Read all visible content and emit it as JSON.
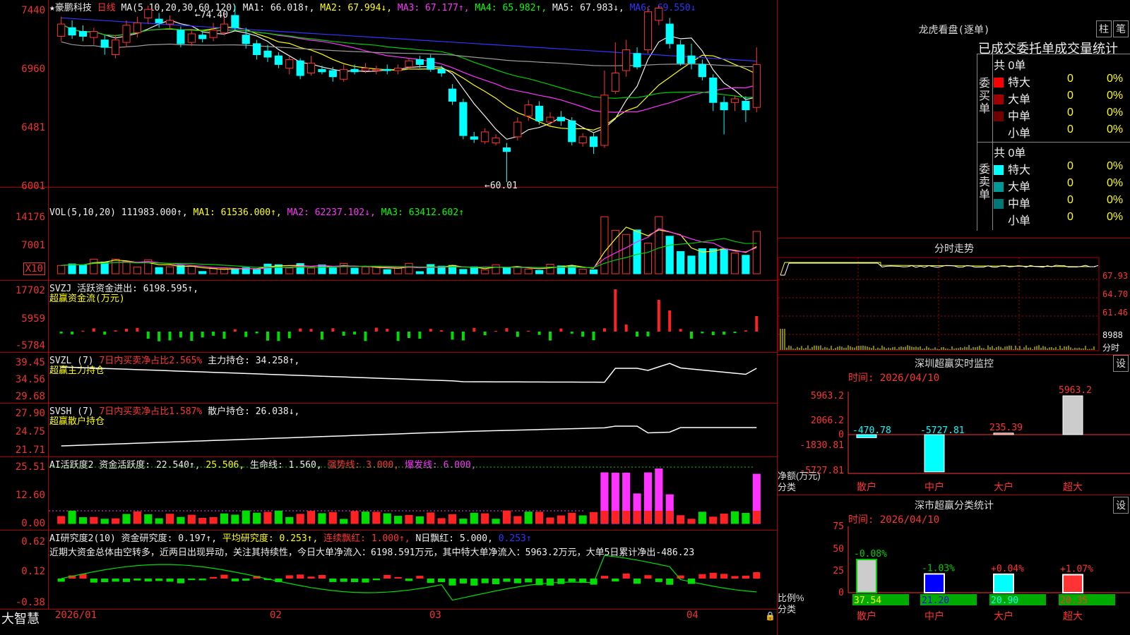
{
  "header": {
    "star": "★",
    "stock_name": "豪鹏科技",
    "period": "日线",
    "ma_label": "MA(5,10,20,30,60,120)",
    "ma1": "MA1: 66.018↑,",
    "ma2": "MA2: 67.994↓,",
    "ma3": "MA3: 67.177↑,",
    "ma4": "MA4: 65.982↑,",
    "ma5": "MA5: 67.983↓,",
    "ma6": "MA6: 69.550↓",
    "high_mark": "←74.40",
    "low_mark": "←60.01"
  },
  "main_axis": [
    "7440",
    "6960",
    "6481",
    "6001"
  ],
  "vol": {
    "title": "VOL(5,10,20)",
    "value": "111983.000↑,",
    "ma1": "MA1: 61536.000↑,",
    "ma2": "MA2: 62237.102↓,",
    "ma3": "MA3: 63412.602↑",
    "axis": [
      "14176",
      "7001"
    ],
    "unit": "X10"
  },
  "svzj": {
    "title": "SVZJ  活跃资金进出: 6198.595↑,",
    "subtitle": "超赢资金流(万元)",
    "axis": [
      "17702",
      "5959",
      "-5784"
    ]
  },
  "svzl": {
    "title": "SVZL (7)",
    "t2": "7日内买卖净占比2.565%",
    "t3": "主力持仓: 34.258↑,",
    "subtitle": "超赢主力持仓",
    "axis": [
      "39.45",
      "34.56",
      "29.68"
    ]
  },
  "svsh": {
    "title": "SVSH (7)",
    "t2": "7日内买卖净占比1.587%",
    "t3": "散户持仓: 26.038↓,",
    "subtitle": "超赢散户持仓",
    "axis": [
      "27.90",
      "24.75",
      "21.71"
    ]
  },
  "ai1": {
    "title": "AI活跃度2 资金活跃度: 22.540↑,",
    "t2": "25.506,",
    "t3": "生命线: 1.560,",
    "t4": "强势线: 3.000,",
    "t5": "爆发线: 6.000,",
    "axis": [
      "25.51",
      "12.60",
      "0.00"
    ]
  },
  "ai2": {
    "title": "AI研究度2(10) 资金研究度: 0.197↑,",
    "t2": "平均研究度: 0.253↑,",
    "t3": "连续飘红: 1.000↑,",
    "t4": "N日飘红: 5.000,",
    "t5": "0.253↑",
    "comment": "近期大资金总体由空转多，近两日出现异动，关注其持续性，今日大单净流入：6198.591万元，其中特大单净流入：5963.2万元，大单5日累计净出-486.23",
    "axis": [
      "0.62",
      "0.12",
      "-0.38"
    ]
  },
  "footer": {
    "brand": "大智慧",
    "dates": [
      "2026/01",
      "02",
      "03",
      "04"
    ]
  },
  "right": {
    "lhb_title": "龙虎看盘(逐单)",
    "btn1": "柱",
    "btn2": "笔",
    "stat_title": "已成交委托单成交量统计",
    "buy_label": "委买单",
    "sell_label": "委卖单",
    "buy_total": "共 0单",
    "sell_total": "共 0单",
    "buy_rows": [
      {
        "name": "特大",
        "count": "0",
        "pct": "0%",
        "color": "#ff0000"
      },
      {
        "name": "大单",
        "count": "0",
        "pct": "0%",
        "color": "#a00000"
      },
      {
        "name": "中单",
        "count": "0",
        "pct": "0%",
        "color": "#700000"
      },
      {
        "name": "小单",
        "count": "0",
        "pct": "0%",
        "color": "#000000"
      }
    ],
    "sell_rows": [
      {
        "name": "特大",
        "count": "0",
        "pct": "0%",
        "color": "#00ffff"
      },
      {
        "name": "大单",
        "count": "0",
        "pct": "0%",
        "color": "#009999"
      },
      {
        "name": "中单",
        "count": "0",
        "pct": "0%",
        "color": "#007777"
      },
      {
        "name": "小单",
        "count": "0",
        "pct": "0%",
        "color": "#000000"
      }
    ],
    "fenshi_title": "分时走势",
    "fenshi_axis": [
      "67.93",
      "64.70",
      "61.46",
      "8988",
      "分时"
    ],
    "monitor_title": "深圳超赢实时监控",
    "monitor_btn": "设",
    "monitor_time": "时间: 2026/04/10",
    "monitor_axis": [
      "5963.2",
      "2066.2",
      "0",
      "-1830.81",
      "-5727.81"
    ],
    "monitor_ylabel1": "净额(万元)",
    "monitor_ylabel2": "分类",
    "monitor_vals": [
      "-470.78",
      "-5727.81",
      "235.39",
      "5963.2"
    ],
    "monitor_cats": [
      "散户",
      "中户",
      "大户",
      "超大"
    ],
    "class_title": "深市超赢分类统计",
    "class_btn": "设",
    "class_time": "时间: 2026/04/10",
    "class_axis": [
      "75",
      "50",
      "25",
      "0"
    ],
    "class_ylabel1": "比例%",
    "class_ylabel2": "分类",
    "class_changes": [
      "-0.08%",
      "-1.03%",
      "+0.04%",
      "+1.07%"
    ],
    "class_vals": [
      "37.54",
      "21.20",
      "20.90",
      "20.35"
    ],
    "class_cats": [
      "散户",
      "中户",
      "大户",
      "超大"
    ]
  },
  "chart_data": {
    "type": "candlestick",
    "title": "豪鹏科技 日线",
    "ylim": [
      60.01,
      74.4
    ],
    "candles": [
      {
        "o": 71.9,
        "c": 72.9,
        "h": 73.5,
        "l": 71.5
      },
      {
        "o": 72.6,
        "c": 72.0,
        "h": 73.2,
        "l": 71.7
      },
      {
        "o": 72.3,
        "c": 71.9,
        "h": 72.8,
        "l": 71.5
      },
      {
        "o": 71.8,
        "c": 72.3,
        "h": 72.6,
        "l": 71.2
      },
      {
        "o": 71.6,
        "c": 71.0,
        "h": 72.0,
        "l": 70.4
      },
      {
        "o": 70.4,
        "c": 71.6,
        "h": 72.0,
        "l": 70.1
      },
      {
        "o": 71.4,
        "c": 72.8,
        "h": 73.2,
        "l": 71.0
      },
      {
        "o": 72.2,
        "c": 73.0,
        "h": 73.5,
        "l": 71.8
      },
      {
        "o": 73.4,
        "c": 74.1,
        "h": 74.4,
        "l": 72.9
      },
      {
        "o": 73.3,
        "c": 73.0,
        "h": 73.8,
        "l": 72.6
      },
      {
        "o": 72.9,
        "c": 73.2,
        "h": 73.6,
        "l": 72.5
      },
      {
        "o": 72.4,
        "c": 71.3,
        "h": 72.7,
        "l": 71.0
      },
      {
        "o": 71.4,
        "c": 72.1,
        "h": 72.5,
        "l": 71.1
      },
      {
        "o": 72.0,
        "c": 71.7,
        "h": 72.3,
        "l": 71.4
      },
      {
        "o": 71.8,
        "c": 72.4,
        "h": 73.0,
        "l": 71.5
      },
      {
        "o": 72.2,
        "c": 72.9,
        "h": 73.8,
        "l": 72.0
      },
      {
        "o": 73.6,
        "c": 72.6,
        "h": 74.4,
        "l": 72.4
      },
      {
        "o": 72.0,
        "c": 71.3,
        "h": 72.6,
        "l": 70.9
      },
      {
        "o": 71.3,
        "c": 70.4,
        "h": 71.6,
        "l": 70.0
      },
      {
        "o": 70.7,
        "c": 70.2,
        "h": 71.2,
        "l": 69.8
      },
      {
        "o": 70.3,
        "c": 69.6,
        "h": 70.6,
        "l": 69.3
      },
      {
        "o": 69.3,
        "c": 70.0,
        "h": 70.3,
        "l": 68.8
      },
      {
        "o": 69.9,
        "c": 68.7,
        "h": 70.1,
        "l": 68.4
      },
      {
        "o": 68.9,
        "c": 69.7,
        "h": 70.3,
        "l": 68.7
      },
      {
        "o": 69.2,
        "c": 69.0,
        "h": 69.5,
        "l": 68.8
      },
      {
        "o": 69.1,
        "c": 68.6,
        "h": 69.4,
        "l": 68.2
      },
      {
        "o": 68.4,
        "c": 69.2,
        "h": 69.6,
        "l": 68.2
      },
      {
        "o": 69.2,
        "c": 69.0,
        "h": 69.6,
        "l": 68.8
      },
      {
        "o": 69.1,
        "c": 69.3,
        "h": 69.7,
        "l": 68.9
      },
      {
        "o": 69.1,
        "c": 69.2,
        "h": 69.5,
        "l": 68.8
      },
      {
        "o": 69.2,
        "c": 69.1,
        "h": 69.6,
        "l": 68.8
      },
      {
        "o": 69.1,
        "c": 69.3,
        "h": 69.6,
        "l": 68.8
      },
      {
        "o": 69.4,
        "c": 69.9,
        "h": 70.1,
        "l": 69.2
      },
      {
        "o": 70.0,
        "c": 69.6,
        "h": 70.3,
        "l": 69.3
      },
      {
        "o": 70.1,
        "c": 69.2,
        "h": 70.4,
        "l": 69.0
      },
      {
        "o": 69.2,
        "c": 68.9,
        "h": 69.5,
        "l": 68.6
      },
      {
        "o": 67.6,
        "c": 66.6,
        "h": 68.0,
        "l": 66.3
      },
      {
        "o": 66.5,
        "c": 63.8,
        "h": 66.8,
        "l": 63.5
      },
      {
        "o": 63.7,
        "c": 63.5,
        "h": 64.1,
        "l": 63.2
      },
      {
        "o": 63.3,
        "c": 64.1,
        "h": 64.4,
        "l": 63.1
      },
      {
        "o": 63.2,
        "c": 63.6,
        "h": 63.9,
        "l": 63.0
      },
      {
        "o": 62.8,
        "c": 62.5,
        "h": 63.2,
        "l": 60.0
      },
      {
        "o": 63.7,
        "c": 64.9,
        "h": 65.3,
        "l": 63.4
      },
      {
        "o": 65.4,
        "c": 66.3,
        "h": 66.7,
        "l": 65.0
      },
      {
        "o": 66.2,
        "c": 65.0,
        "h": 66.6,
        "l": 64.7
      },
      {
        "o": 64.9,
        "c": 65.3,
        "h": 65.7,
        "l": 64.6
      },
      {
        "o": 65.3,
        "c": 65.0,
        "h": 65.8,
        "l": 64.6
      },
      {
        "o": 65.0,
        "c": 63.3,
        "h": 65.3,
        "l": 63.0
      },
      {
        "o": 63.2,
        "c": 63.7,
        "h": 64.0,
        "l": 62.9
      },
      {
        "o": 63.7,
        "c": 62.9,
        "h": 64.0,
        "l": 62.3
      },
      {
        "o": 63.0,
        "c": 67.1,
        "h": 69.1,
        "l": 62.8
      },
      {
        "o": 67.4,
        "c": 68.9,
        "h": 71.4,
        "l": 67.2
      },
      {
        "o": 69.1,
        "c": 70.8,
        "h": 71.6,
        "l": 68.6
      },
      {
        "o": 70.5,
        "c": 69.4,
        "h": 71.0,
        "l": 69.2
      },
      {
        "o": 70.8,
        "c": 73.9,
        "h": 74.3,
        "l": 70.5
      },
      {
        "o": 73.2,
        "c": 74.2,
        "h": 74.4,
        "l": 72.8
      },
      {
        "o": 72.9,
        "c": 71.3,
        "h": 73.4,
        "l": 70.9
      },
      {
        "o": 71.2,
        "c": 69.7,
        "h": 71.6,
        "l": 69.5
      },
      {
        "o": 70.3,
        "c": 69.7,
        "h": 71.3,
        "l": 69.2
      },
      {
        "o": 69.6,
        "c": 68.6,
        "h": 70.0,
        "l": 68.3
      },
      {
        "o": 68.5,
        "c": 66.5,
        "h": 68.8,
        "l": 65.8
      },
      {
        "o": 66.5,
        "c": 65.9,
        "h": 67.0,
        "l": 63.9
      },
      {
        "o": 66.5,
        "c": 66.8,
        "h": 67.1,
        "l": 65.8
      },
      {
        "o": 66.6,
        "c": 65.9,
        "h": 67.0,
        "l": 64.9
      },
      {
        "o": 66.1,
        "c": 69.6,
        "h": 71.0,
        "l": 65.7
      }
    ]
  }
}
